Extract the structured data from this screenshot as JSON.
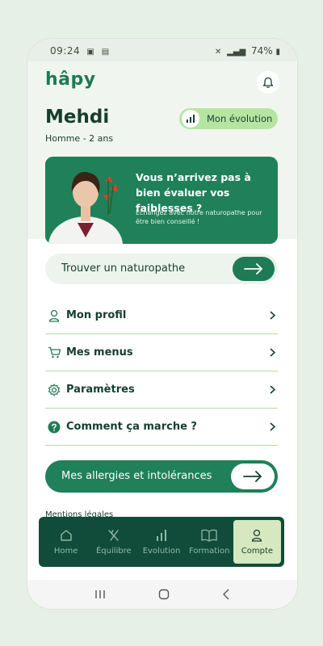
{
  "status_bar": {
    "time": "09:24",
    "battery": "74%"
  },
  "brand": {
    "logo": "hâpy"
  },
  "profile": {
    "name": "Mehdi",
    "details": "Homme - 2 ans"
  },
  "evolution_button": {
    "label": "Mon évolution",
    "icon": "bar-chart-icon"
  },
  "promo": {
    "title": "Vous n’arrivez pas à bien évaluer vos faiblesses ?",
    "body": "Échangez avec notre naturopathe pour être bien conseillé !"
  },
  "find_naturopath": {
    "label": "Trouver un naturopathe"
  },
  "menu": [
    {
      "label": "Mon profil",
      "icon": "user-icon"
    },
    {
      "label": "Mes menus",
      "icon": "cart-icon"
    },
    {
      "label": "Paramètres",
      "icon": "gear-icon"
    },
    {
      "label": "Comment ça marche ?",
      "icon": "help-icon"
    }
  ],
  "allergies_button": {
    "label": "Mes allergies et intolérances"
  },
  "legal": {
    "label": "Mentions légales"
  },
  "tabs": [
    {
      "label": "Home",
      "icon": "home-icon",
      "active": false
    },
    {
      "label": "Équilibre",
      "icon": "utensils-icon",
      "active": false
    },
    {
      "label": "Evolution",
      "icon": "bar-chart-icon",
      "active": false
    },
    {
      "label": "Formation",
      "icon": "book-icon",
      "active": false
    },
    {
      "label": "Compte",
      "icon": "user-icon",
      "active": true
    }
  ],
  "colors": {
    "primary": "#1f8059",
    "dark": "#114c3a",
    "accent": "#b6e5a2",
    "background": "#e6f0e6"
  }
}
